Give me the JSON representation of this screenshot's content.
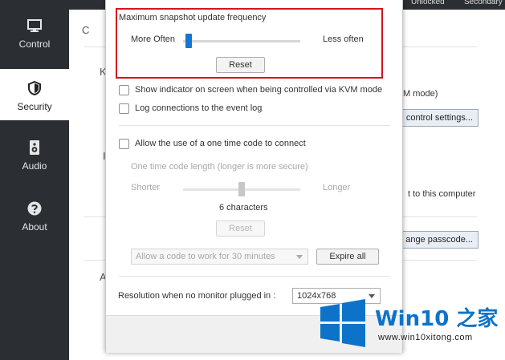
{
  "sidebar": {
    "items": [
      {
        "label": "Control",
        "icon": "monitor-icon"
      },
      {
        "label": "Security",
        "icon": "shield-icon",
        "active": true
      },
      {
        "label": "Audio",
        "icon": "speaker-icon"
      },
      {
        "label": "About",
        "icon": "help-icon"
      }
    ]
  },
  "top_strip": {
    "left": "Unlocked",
    "right": "Secondary"
  },
  "background": {
    "partial_heading_1": "K",
    "partial_heading_2": "I",
    "partial_heading_3": "A",
    "partial_icon_letter": "C",
    "kvm_mode_text": "M mode)",
    "control_settings_button": "control settings...",
    "connect_text": "t to this computer",
    "change_passcode_button": "ange passcode..."
  },
  "dialog": {
    "snapshot": {
      "title": "Maximum snapshot update frequency",
      "left_label": "More Often",
      "right_label": "Less often",
      "slider_value": 0.02,
      "reset_label": "Reset"
    },
    "checkboxes": [
      {
        "label": "Show indicator on screen when being controlled via KVM mode",
        "checked": false
      },
      {
        "label": "Log connections to the event log",
        "checked": false
      }
    ],
    "one_time_code": {
      "checkbox_label": "Allow the use of a one time code to connect",
      "checked": false,
      "length_label": "One time code length (longer is more secure)",
      "shorter_label": "Shorter",
      "longer_label": "Longer",
      "slider_value": 0.5,
      "value_text": "6 characters",
      "reset_label": "Reset",
      "duration_select": "Allow a code to work for 30 minutes",
      "expire_label": "Expire all"
    },
    "resolution": {
      "label": "Resolution when no monitor plugged in :",
      "value": "1024x768"
    }
  },
  "watermark": {
    "title": "Win10 之家",
    "url": "www.win10xitong.com"
  },
  "colors": {
    "sidebar_bg": "#2b2e33",
    "highlight_border": "#d6141c",
    "slider_thumb": "#1476d2",
    "watermark_blue": "#0d73c9"
  }
}
